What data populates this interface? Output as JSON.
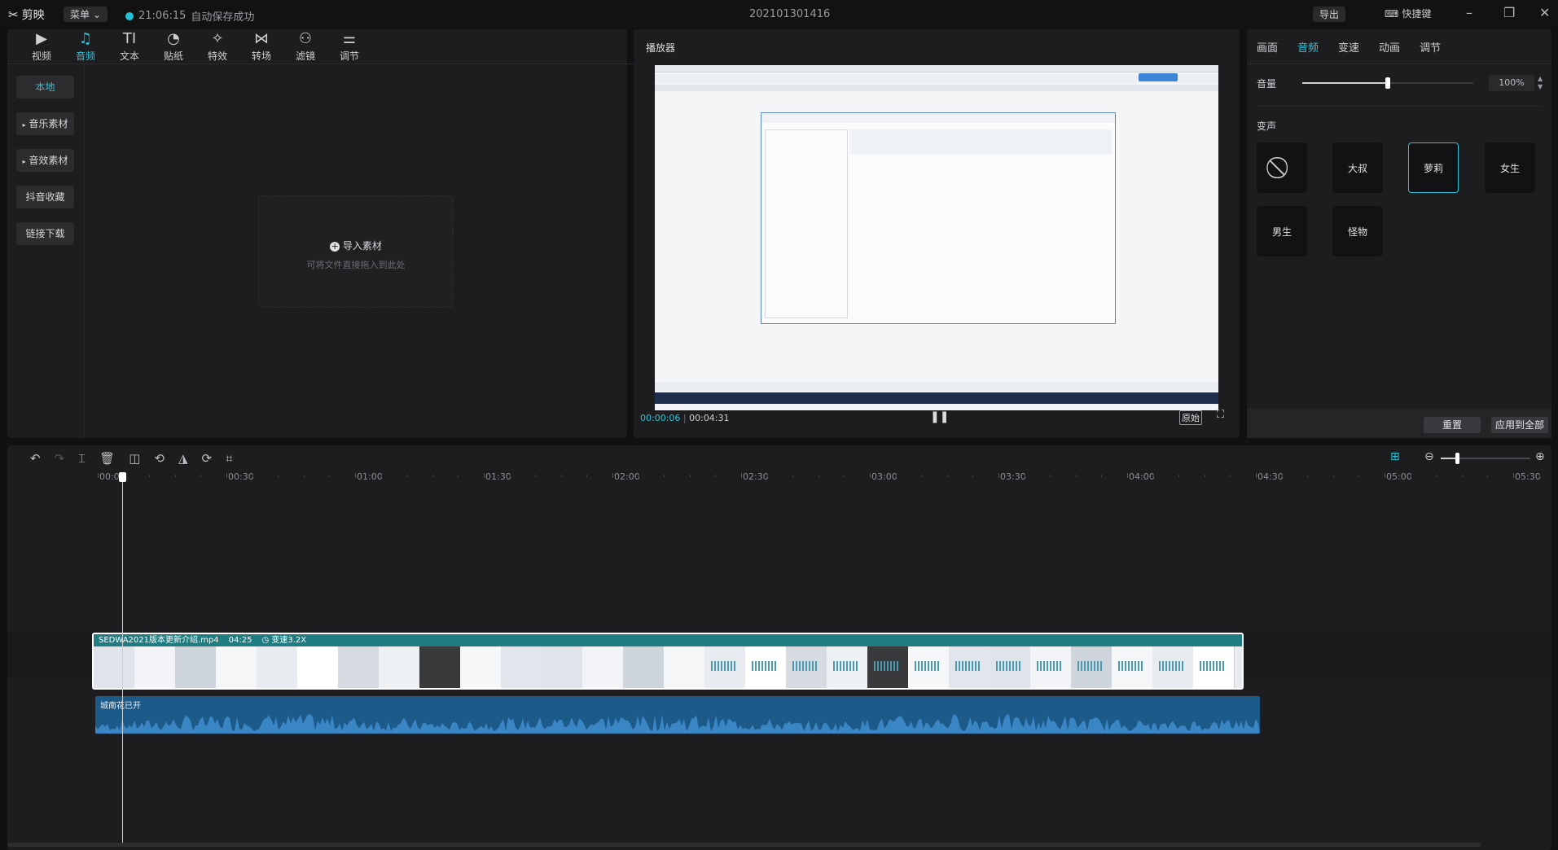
{
  "app": {
    "logo_text": "剪映",
    "menu_label": "菜单",
    "save_time": "21:06:15",
    "save_status": "自动保存成功",
    "project_title": "202101301416",
    "export_label": "导出",
    "shortcut_label": "快捷键"
  },
  "toolbar": [
    {
      "label": "视频",
      "icon": "video-icon",
      "glyph": "▶"
    },
    {
      "label": "音频",
      "icon": "audio-icon",
      "glyph": "♫"
    },
    {
      "label": "文本",
      "icon": "text-icon",
      "glyph": "TI"
    },
    {
      "label": "贴纸",
      "icon": "sticker-icon",
      "glyph": "◔"
    },
    {
      "label": "特效",
      "icon": "effects-icon",
      "glyph": "✧"
    },
    {
      "label": "转场",
      "icon": "transition-icon",
      "glyph": "⋈"
    },
    {
      "label": "滤镜",
      "icon": "filter-icon",
      "glyph": "⚇"
    },
    {
      "label": "调节",
      "icon": "adjust-icon",
      "glyph": "⚌"
    }
  ],
  "sidebar": [
    {
      "label": "本地"
    },
    {
      "label": "音乐素材"
    },
    {
      "label": "音效素材"
    },
    {
      "label": "抖音收藏"
    },
    {
      "label": "链接下载"
    }
  ],
  "import": {
    "label": "导入素材",
    "hint": "可将文件直接拖入到此处"
  },
  "player": {
    "title": "播放器",
    "current_time": "00:00:06",
    "total_time": "00:04:31",
    "ratio_label": "原始"
  },
  "right_panel": {
    "tabs": [
      {
        "label": "画面"
      },
      {
        "label": "音频"
      },
      {
        "label": "变速"
      },
      {
        "label": "动画"
      },
      {
        "label": "调节"
      }
    ],
    "volume_label": "音量",
    "volume_value": "100%",
    "volume_level": 0.5,
    "voice_change_label": "变声",
    "voices": [
      {
        "label": ""
      },
      {
        "label": "大叔"
      },
      {
        "label": "萝莉"
      },
      {
        "label": "女生"
      },
      {
        "label": "男生"
      },
      {
        "label": "怪物"
      }
    ],
    "reset_label": "重置",
    "apply_all_label": "应用到全部"
  },
  "timeline": {
    "ticks": [
      "00:00",
      "00:30",
      "01:00",
      "01:30",
      "02:00",
      "02:30",
      "03:00",
      "03:30",
      "04:00",
      "04:30",
      "05:00",
      "05:30"
    ],
    "video_clip": {
      "filename": "SEDWA2021版本更新介绍.mp4",
      "duration": "04:25",
      "speed": "变速3.2X"
    },
    "audio_clip": {
      "name": "城南花已开"
    }
  },
  "colors": {
    "accent": "#2fc4d8",
    "clip_teal": "#1f7c80",
    "audio_blue": "#1c5a8a"
  }
}
